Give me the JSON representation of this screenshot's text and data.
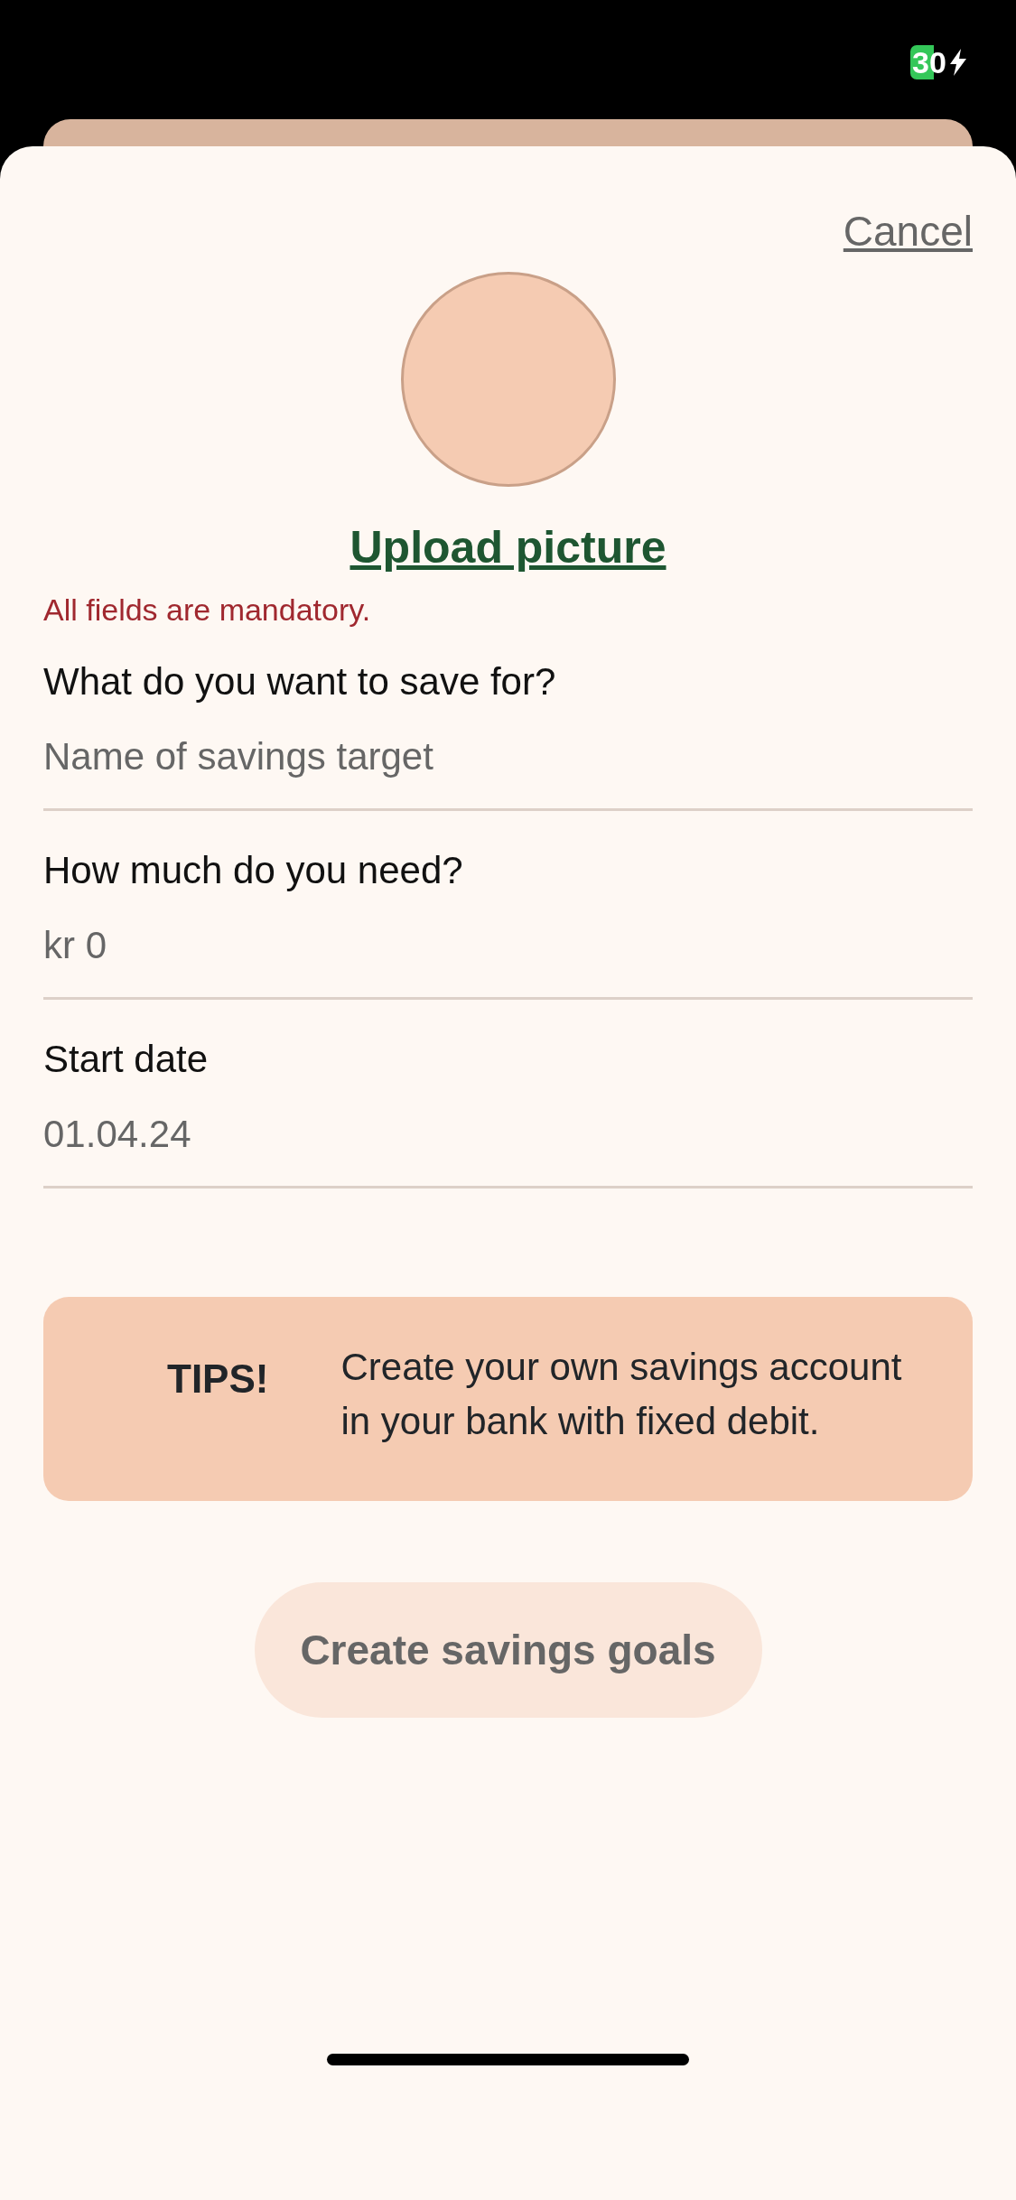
{
  "status_bar": {
    "battery": "30"
  },
  "cancel": "Cancel",
  "upload": "Upload picture",
  "notice": "All fields are mandatory.",
  "fields": [
    {
      "label": "What do you want to save for?",
      "placeholder": "Name of savings target"
    },
    {
      "label": "How much do you need?",
      "placeholder": "kr 0"
    },
    {
      "label": "Start date",
      "value": "01.04.24"
    }
  ],
  "tip": {
    "title": "TIPS!",
    "text": "Create your own savings account in your bank with fixed debit."
  },
  "submit": {
    "label": "Create savings goals",
    "disabled": true
  }
}
